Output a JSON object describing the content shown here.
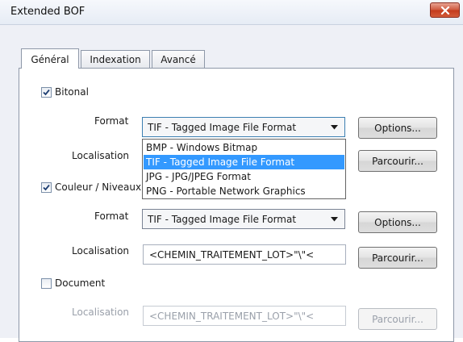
{
  "window": {
    "title": "Extended BOF"
  },
  "tabs": [
    {
      "label": "Général",
      "active": true
    },
    {
      "label": "Indexation",
      "active": false
    },
    {
      "label": "Avancé",
      "active": false
    }
  ],
  "bitonal": {
    "label": "Bitonal",
    "checked": true,
    "format_label": "Format",
    "format_value": "TIF - Tagged Image File Format",
    "options_button": "Options...",
    "location_label": "Localisation",
    "browse_button": "Parcourir..."
  },
  "dropdown": {
    "options": [
      {
        "label": "BMP - Windows Bitmap",
        "selected": false
      },
      {
        "label": "TIF - Tagged Image File Format",
        "selected": true
      },
      {
        "label": "JPG - JPG/JPEG Format",
        "selected": false
      },
      {
        "label": "PNG - Portable Network Graphics",
        "selected": false
      }
    ]
  },
  "color": {
    "label": "Couleur / Niveaux de gris",
    "checked": true,
    "format_label": "Format",
    "format_value": "TIF - Tagged Image File Format",
    "options_button": "Options...",
    "location_label": "Localisation",
    "location_value": "<CHEMIN_TRAITEMENT_LOT>\"\\\"<",
    "browse_button": "Parcourir..."
  },
  "document": {
    "label": "Document",
    "checked": false,
    "location_label": "Localisation",
    "location_value": "<CHEMIN_TRAITEMENT_LOT>\"\\\"<",
    "browse_button": "Parcourir..."
  },
  "colors": {
    "selection": "#3399ff",
    "close_button": "#c43a1c",
    "focus_border": "#3c7fb1"
  },
  "icons": {
    "close": "close-icon",
    "check": "checkmark-icon",
    "dropdown": "chevron-down-icon"
  }
}
